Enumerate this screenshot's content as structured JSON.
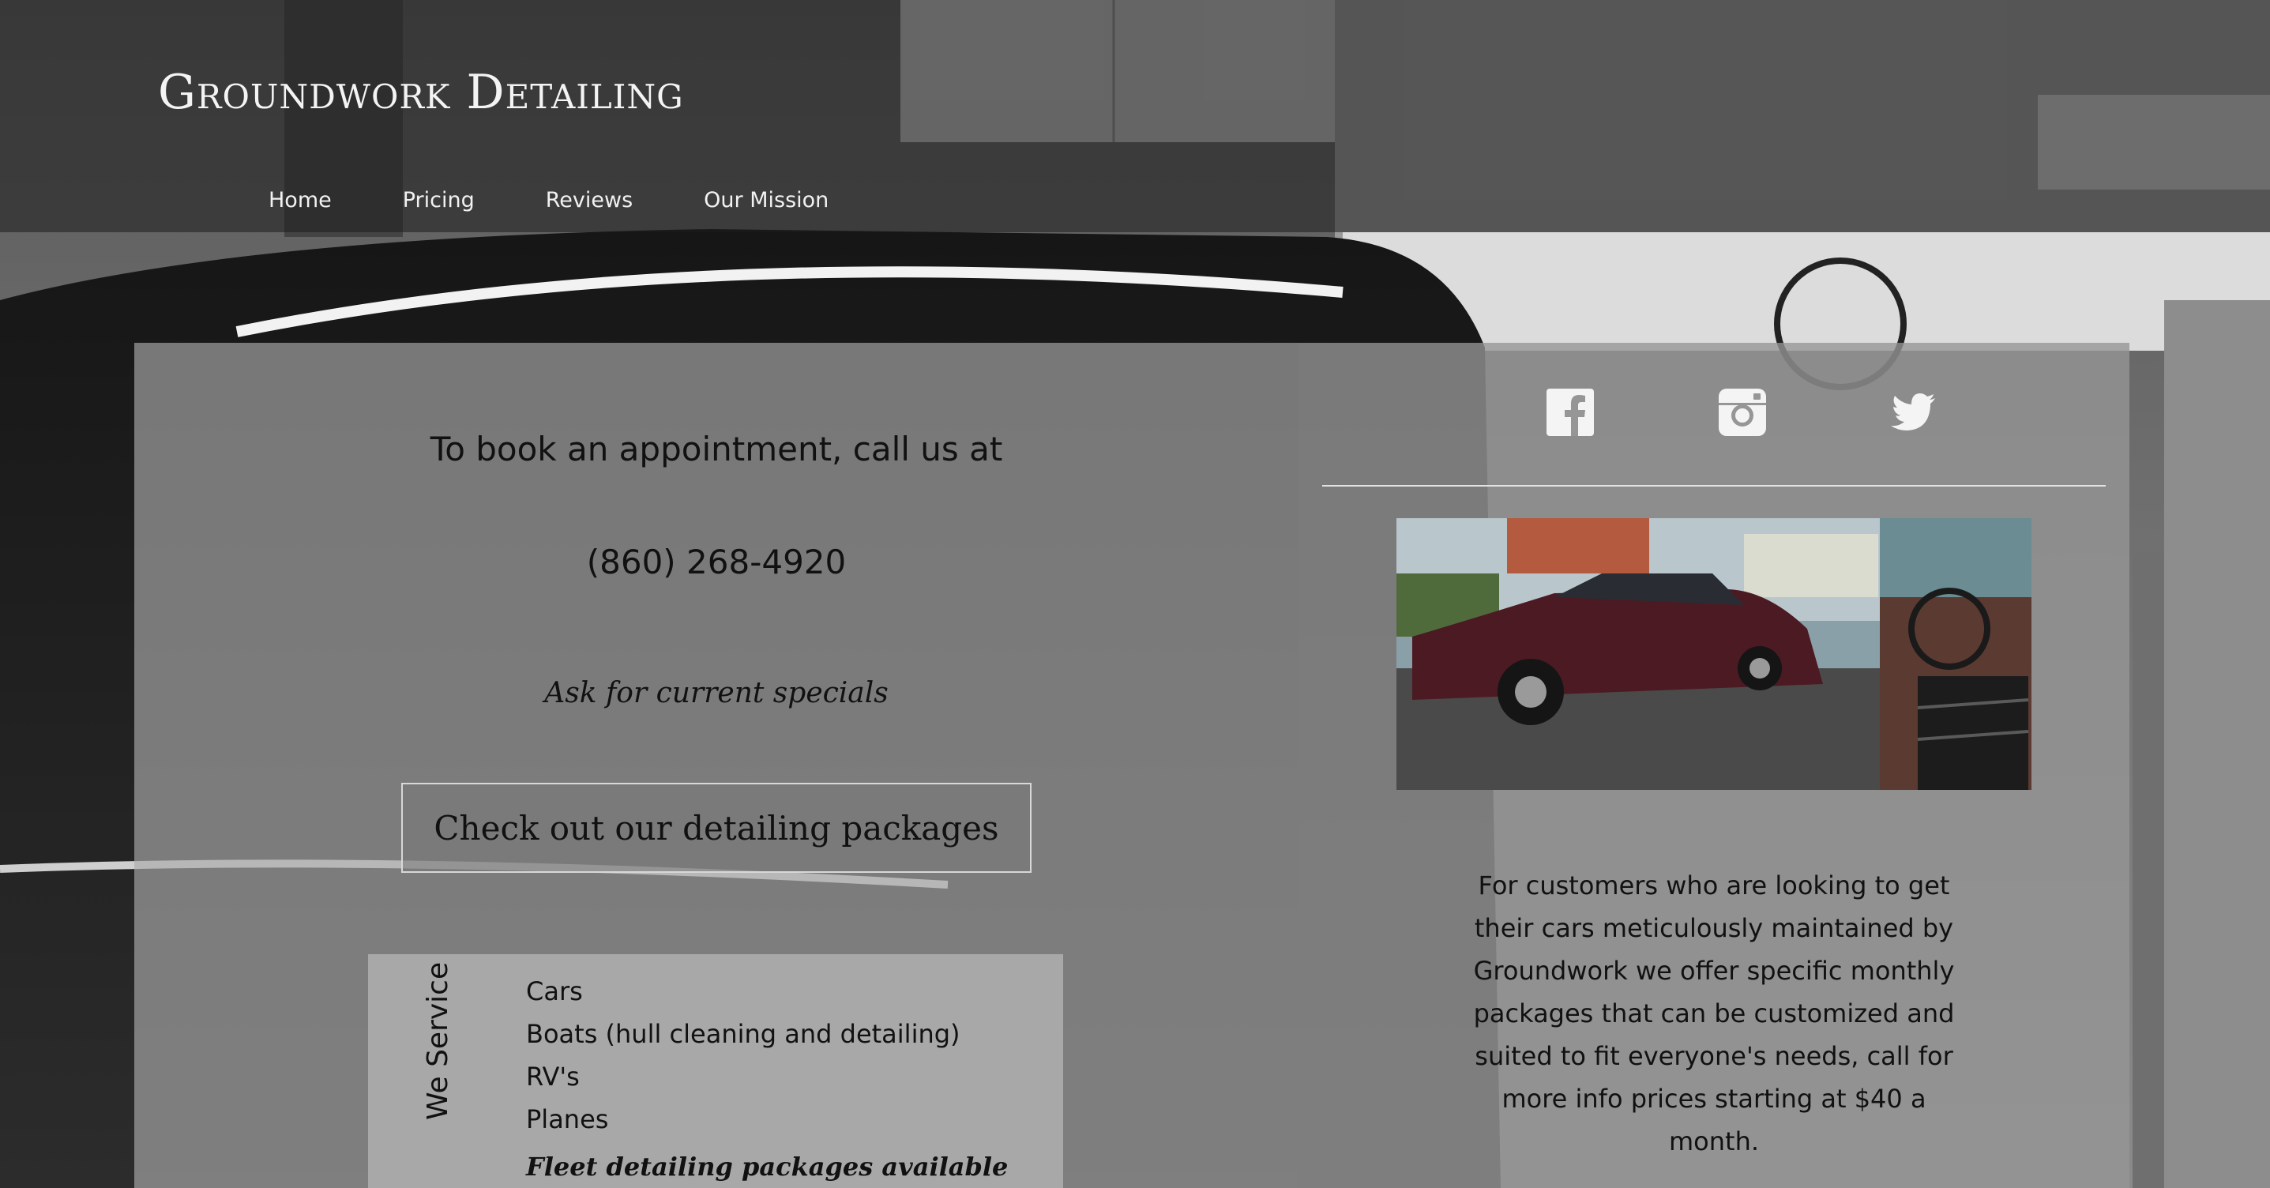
{
  "header": {
    "title": "Groundwork Detailing",
    "nav": [
      "Home",
      "Pricing",
      "Reviews",
      "Our Mission"
    ]
  },
  "booking": {
    "heading": "To book an appointment, call us at",
    "phone": "(860) 268-4920",
    "specials": "Ask for current specials",
    "packages_button": "Check out our detailing packages"
  },
  "services": {
    "label": "We Service",
    "items": [
      "Cars",
      "Boats (hull cleaning and detailing)",
      "RV's",
      "Planes"
    ],
    "partial_note": "Fleet detailing packages available"
  },
  "social": {
    "icons": [
      "facebook-icon",
      "instagram-icon",
      "twitter-icon"
    ]
  },
  "about": {
    "text": "For customers who are looking to get their cars meticulously maintained by Groundwork we offer specific monthly packages that can be customized and suited to fit everyone's needs, call for more info prices starting at $40 a month."
  },
  "colors": {
    "header_overlay": "#1e1e1e",
    "left_panel": "#aaaaaa",
    "right_panel": "#969696",
    "text": "#111111"
  }
}
